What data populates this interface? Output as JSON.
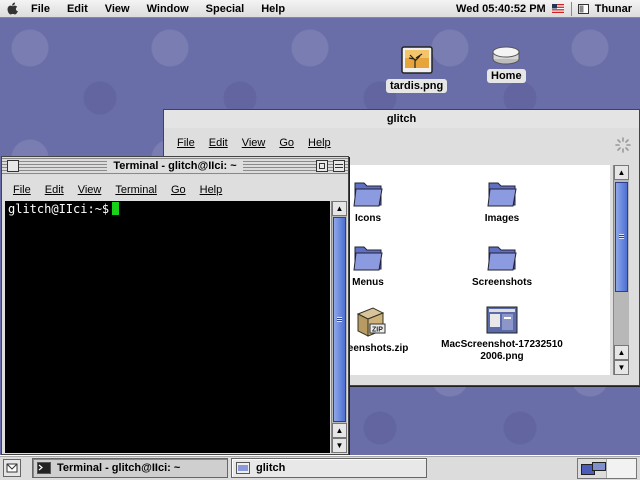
{
  "menubar": {
    "items": [
      "File",
      "Edit",
      "View",
      "Window",
      "Special",
      "Help"
    ],
    "clock": "Wed 05:40:52 PM",
    "app_name": "Thunar"
  },
  "desktop": {
    "icons": [
      {
        "label": "tardis.png",
        "icon": "image-file-icon"
      },
      {
        "label": "Home",
        "icon": "hard-drive-icon"
      }
    ]
  },
  "file_manager": {
    "title": "glitch",
    "menu": [
      "File",
      "Edit",
      "View",
      "Go",
      "Help"
    ],
    "items": [
      {
        "label": "Icons",
        "icon": "folder-icon"
      },
      {
        "label": "Images",
        "icon": "folder-icon"
      },
      {
        "label": "Menus",
        "icon": "folder-icon"
      },
      {
        "label": "Screenshots",
        "icon": "folder-icon"
      },
      {
        "label": "Screenshots.zip",
        "icon": "zip-archive-icon"
      },
      {
        "label": "MacScreenshot-17232510\n2006.png",
        "icon": "image-thumbnail-icon"
      }
    ]
  },
  "terminal": {
    "title": "Terminal - glitch@IIci: ~",
    "menu": [
      "File",
      "Edit",
      "View",
      "Terminal",
      "Go",
      "Help"
    ],
    "prompt": "glitch@IIci:~$"
  },
  "taskbar": {
    "tasks": [
      {
        "label": "Terminal - glitch@IIci: ~",
        "active": true
      },
      {
        "label": "glitch",
        "active": false
      }
    ]
  },
  "colors": {
    "desktop": "#6a6ea8",
    "cursor": "#18d318",
    "scroll_thumb": "#6d8be0",
    "folder": "#7f8fd8"
  }
}
